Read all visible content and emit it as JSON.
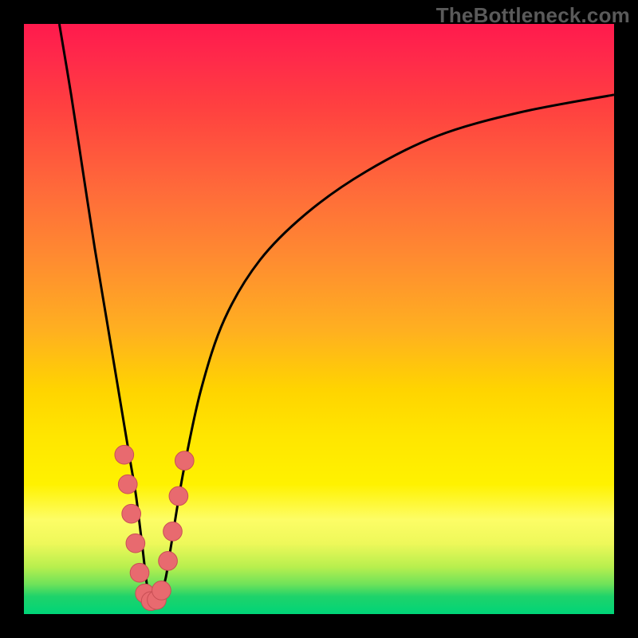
{
  "watermark": "TheBottleneck.com",
  "colors": {
    "frame": "#000000",
    "curve": "#000000",
    "marker_fill": "#e86a6f",
    "marker_stroke": "#c94f55",
    "gradient_top": "#ff1a4d",
    "gradient_bottom": "#00d478"
  },
  "chart_data": {
    "type": "line",
    "title": "",
    "xlabel": "",
    "ylabel": "",
    "xlim": [
      0,
      100
    ],
    "ylim": [
      0,
      100
    ],
    "note": "values are visual percentages of the 740×740 plot area (0,0 bottom-left)",
    "series": [
      {
        "name": "v-curve",
        "x": [
          6,
          8,
          10,
          12,
          14,
          16,
          17,
          18,
          19,
          20,
          21,
          22,
          23,
          24,
          25,
          27,
          30,
          34,
          40,
          48,
          58,
          70,
          84,
          100
        ],
        "y": [
          100,
          88,
          75,
          62,
          50,
          38,
          32,
          26,
          20,
          12,
          4,
          2,
          3,
          6,
          12,
          24,
          38,
          50,
          60,
          68,
          75,
          81,
          85,
          88
        ]
      }
    ],
    "markers": {
      "name": "lobe-markers",
      "points": [
        {
          "x": 17.0,
          "y": 27
        },
        {
          "x": 17.6,
          "y": 22
        },
        {
          "x": 18.2,
          "y": 17
        },
        {
          "x": 18.9,
          "y": 12
        },
        {
          "x": 19.6,
          "y": 7
        },
        {
          "x": 20.5,
          "y": 3.5
        },
        {
          "x": 21.5,
          "y": 2.2
        },
        {
          "x": 22.5,
          "y": 2.4
        },
        {
          "x": 23.3,
          "y": 4
        },
        {
          "x": 24.4,
          "y": 9
        },
        {
          "x": 25.2,
          "y": 14
        },
        {
          "x": 26.2,
          "y": 20
        },
        {
          "x": 27.2,
          "y": 26
        }
      ],
      "radius_pct": 1.6
    }
  }
}
